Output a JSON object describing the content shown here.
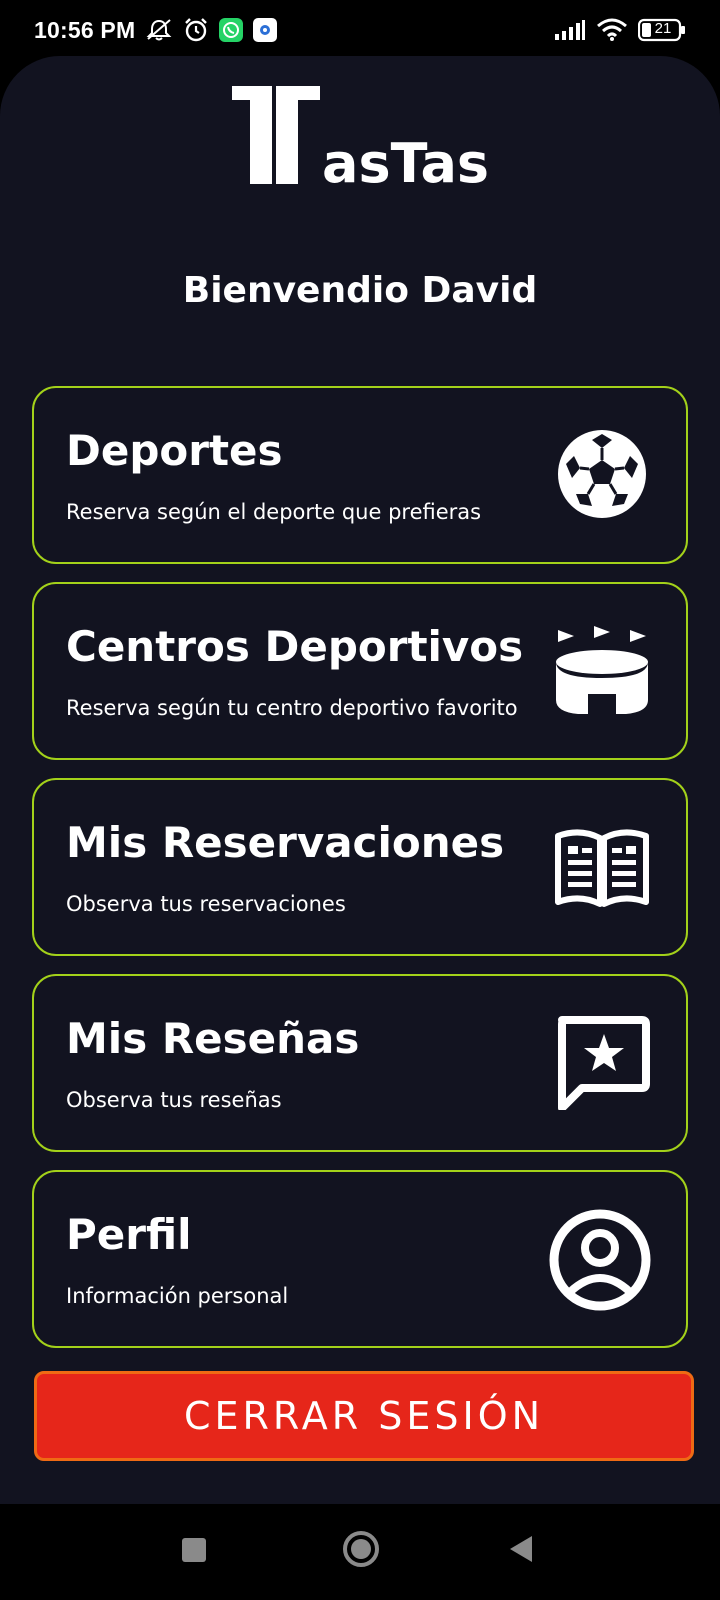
{
  "status_bar": {
    "time": "10:56 PM",
    "battery": "21",
    "icons": [
      "mute-icon",
      "alarm-icon",
      "whatsapp-icon",
      "settings-app-icon",
      "signal-icon",
      "wifi-icon",
      "battery-icon"
    ]
  },
  "app": {
    "logo_text": "asTas",
    "greeting": "Bienvendio David"
  },
  "menu": {
    "items": [
      {
        "title": "Deportes",
        "subtitle": "Reserva según el deporte que prefieras",
        "icon": "soccer-ball-icon"
      },
      {
        "title": "Centros Deportivos",
        "subtitle": "Reserva según tu centro deportivo favorito",
        "icon": "stadium-icon"
      },
      {
        "title": "Mis Reservaciones",
        "subtitle": "Observa tus reservaciones",
        "icon": "open-book-icon"
      },
      {
        "title": "Mis Reseñas",
        "subtitle": "Observa tus reseñas",
        "icon": "star-message-icon"
      },
      {
        "title": "Perfil",
        "subtitle": "Información personal",
        "icon": "user-profile-icon"
      }
    ]
  },
  "logout_label": "CERRAR SESIÓN",
  "colors": {
    "background": "#121320",
    "card_border": "#a3d11a",
    "logout_bg": "#e6261a",
    "logout_border": "#ef6a14"
  }
}
